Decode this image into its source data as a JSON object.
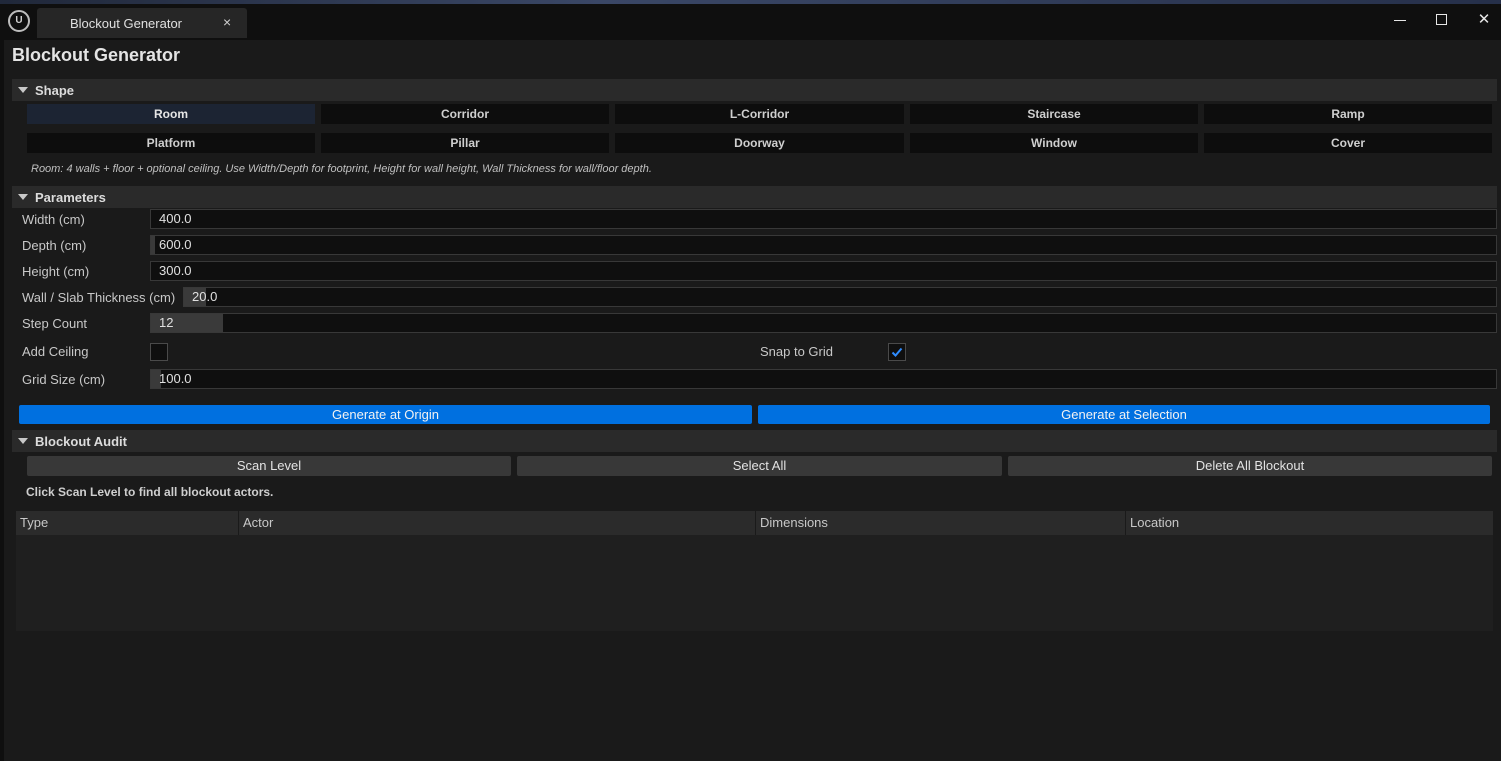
{
  "window": {
    "tab_label": "Blockout Generator",
    "tab_close_glyph": "×",
    "minimize_icon": "minimize-icon",
    "maximize_icon": "maximize-icon",
    "close_icon": "close-icon",
    "close_glyph": "✕",
    "logo": "ue-logo-icon"
  },
  "page_title": "Blockout Generator",
  "shape": {
    "header": "Shape",
    "buttons": [
      {
        "label": "Room",
        "active": true
      },
      {
        "label": "Corridor"
      },
      {
        "label": "L-Corridor"
      },
      {
        "label": "Staircase"
      },
      {
        "label": "Ramp"
      },
      {
        "label": "Platform"
      },
      {
        "label": "Pillar"
      },
      {
        "label": "Doorway"
      },
      {
        "label": "Window"
      },
      {
        "label": "Cover"
      }
    ],
    "hint": "Room: 4 walls + floor + optional ceiling. Use Width/Depth for footprint, Height for wall height, Wall Thickness for wall/floor depth."
  },
  "parameters": {
    "header": "Parameters",
    "width": {
      "label": "Width (cm)",
      "value": "400.0"
    },
    "depth": {
      "label": "Depth (cm)",
      "value": "600.0"
    },
    "height": {
      "label": "Height (cm)",
      "value": "300.0"
    },
    "thickness": {
      "label": "Wall / Slab Thickness (cm)",
      "value": "20.0"
    },
    "step_count": {
      "label": "Step Count",
      "value": "12"
    },
    "add_ceiling": {
      "label": "Add Ceiling",
      "checked": false
    },
    "snap_to_grid": {
      "label": "Snap to Grid",
      "checked": true
    },
    "grid_size": {
      "label": "Grid Size (cm)",
      "value": "100.0"
    }
  },
  "actions": {
    "generate_origin": "Generate at Origin",
    "generate_selection": "Generate at Selection"
  },
  "audit": {
    "header": "Blockout Audit",
    "scan": "Scan Level",
    "select_all": "Select All",
    "delete_all": "Delete All Blockout",
    "message": "Click Scan Level to find all blockout actors.",
    "columns": [
      "Type",
      "Actor",
      "Dimensions",
      "Location"
    ]
  },
  "colors": {
    "accent": "#0070e0",
    "background": "#1a1a1a",
    "checkmark": "#2f8cff"
  }
}
